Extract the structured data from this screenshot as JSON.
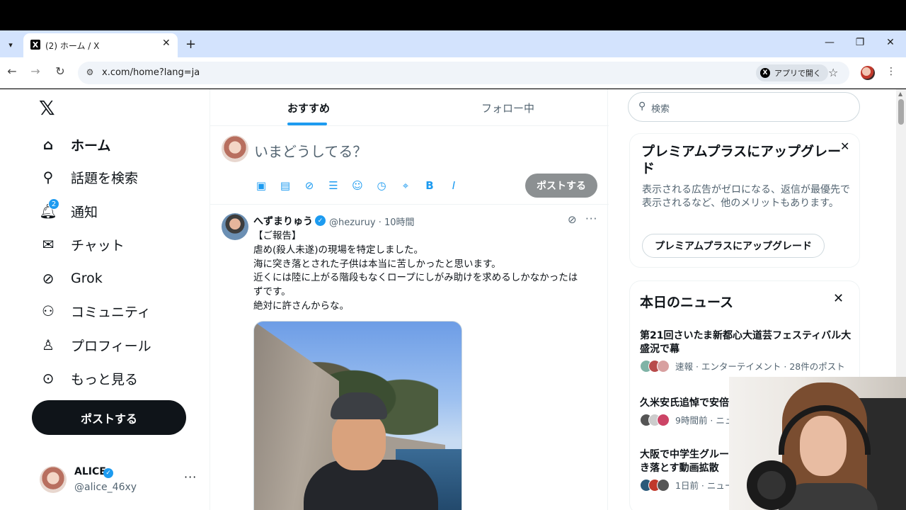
{
  "browser": {
    "tab_title": "(2) ホーム / X",
    "url": "x.com/home?lang=ja",
    "open_in_app": "アプリで開く"
  },
  "sidebar": {
    "logo": "𝕏",
    "items": [
      {
        "label": "ホーム",
        "icon": "home-icon"
      },
      {
        "label": "話題を検索",
        "icon": "search-icon"
      },
      {
        "label": "通知",
        "icon": "bell-icon",
        "badge": "2"
      },
      {
        "label": "チャット",
        "icon": "mail-icon"
      },
      {
        "label": "Grok",
        "icon": "grok-icon"
      },
      {
        "label": "コミュニティ",
        "icon": "people-icon"
      },
      {
        "label": "プロフィール",
        "icon": "person-icon"
      },
      {
        "label": "もっと見る",
        "icon": "more-circle-icon"
      }
    ],
    "post_button": "ポストする",
    "account": {
      "name": "ALICE",
      "handle": "@alice_46xy"
    }
  },
  "timeline": {
    "tabs": [
      "おすすめ",
      "フォロー中"
    ],
    "composer": {
      "placeholder": "いまどうしてる？",
      "post_button": "ポストする"
    },
    "tweet": {
      "name": "へずまりゅう",
      "handle_time": "@hezuruy · 10時間",
      "lines": [
        "【ご報告】",
        "虐め(殺人未遂)の現場を特定しました。",
        "海に突き落とされた子供は本当に苦しかったと思います。",
        "近くには陸に上がる階段もなくロープにしがみ助けを求めるしかなかったは",
        "ずです。",
        "絶対に許さんからな。"
      ]
    }
  },
  "right": {
    "search_placeholder": "検索",
    "premium": {
      "title": "プレミアムプラスにアップグレード",
      "desc": "表示される広告がゼロになる、返信が最優先で表示されるなど、他のメリットもあります。",
      "button": "プレミアムプラスにアップグレード"
    },
    "news": {
      "title": "本日のニュース",
      "items": [
        {
          "headline": "第21回さいたま新都心大道芸フェスティバル大盛況で幕",
          "meta": "速報 · エンターテイメント · 28件のポスト"
        },
        {
          "headline": "久米安氏追悼で安倍",
          "meta": "9時間前 · ニュ"
        },
        {
          "headline": "大阪で中学生グルー\nき落とす動画拡散",
          "meta": "1日前 · ニュー"
        }
      ]
    }
  }
}
